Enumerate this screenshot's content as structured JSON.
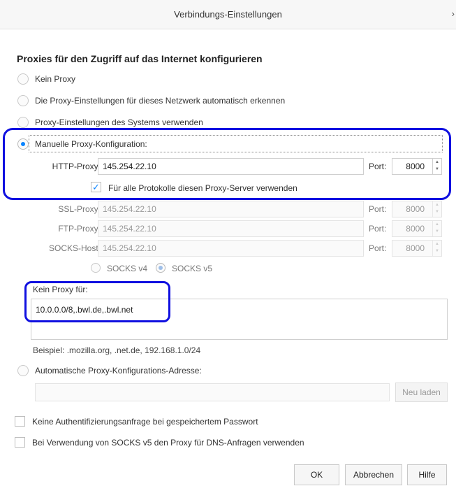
{
  "window": {
    "title": "Verbindungs-Einstellungen",
    "close_glyph": "›"
  },
  "heading": "Proxies für den Zugriff auf das Internet konfigurieren",
  "proxy_options": {
    "no_proxy": {
      "label": "Kein Proxy",
      "selected": false
    },
    "auto_detect": {
      "label": "Die Proxy-Einstellungen für dieses Netzwerk automatisch erkennen",
      "selected": false
    },
    "system": {
      "label": "Proxy-Einstellungen des Systems verwenden",
      "selected": false
    },
    "manual": {
      "label": "Manuelle Proxy-Konfiguration:",
      "selected": true
    },
    "auto_url": {
      "label": "Automatische Proxy-Konfigurations-Adresse:",
      "selected": false
    }
  },
  "manual": {
    "http_label": "HTTP-Proxy:",
    "http_value": "145.254.22.10",
    "http_port_label": "Port:",
    "http_port_value": "8000",
    "all_protocols_label": "Für alle Protokolle diesen Proxy-Server verwenden",
    "all_protocols_checked": true,
    "ssl_label": "SSL-Proxy:",
    "ssl_value": "145.254.22.10",
    "ssl_port_label": "Port:",
    "ssl_port_value": "8000",
    "ftp_label": "FTP-Proxy:",
    "ftp_value": "145.254.22.10",
    "ftp_port_label": "Port:",
    "ftp_port_value": "8000",
    "socks_label": "SOCKS-Host:",
    "socks_value": "145.254.22.10",
    "socks_port_label": "Port:",
    "socks_port_value": "8000",
    "socks_v4_label": "SOCKS v4",
    "socks_v5_label": "SOCKS v5",
    "socks_version_selected": "SOCKS v5"
  },
  "no_proxy_for": {
    "label": "Kein Proxy für:",
    "value": "10.0.0.0/8,.bwl.de,.bwl.net",
    "example": "Beispiel: .mozilla.org, .net.de, 192.168.1.0/24"
  },
  "auto_url": {
    "value": "",
    "reload_label": "Neu laden"
  },
  "checkboxes": {
    "no_auth_prompt": {
      "label": "Keine Authentifizierungsanfrage bei gespeichertem Passwort",
      "checked": false
    },
    "socks_dns": {
      "label": "Bei Verwendung von SOCKS v5 den Proxy für DNS-Anfragen verwenden",
      "checked": false
    }
  },
  "buttons": {
    "ok": "OK",
    "cancel": "Abbrechen",
    "help": "Hilfe"
  },
  "colors": {
    "accent": "#0a84ff",
    "annotation": "#1010e0"
  }
}
